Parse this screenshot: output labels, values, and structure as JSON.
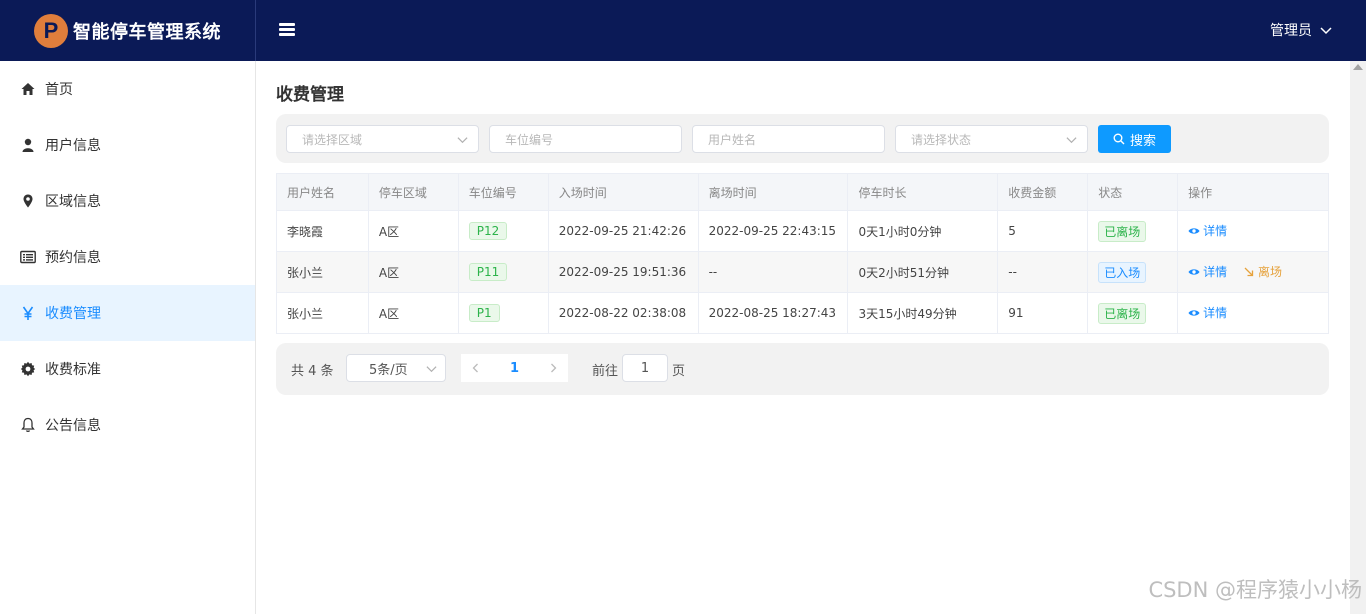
{
  "app": {
    "logo_letter": "P",
    "title": "智能停车管理系统",
    "user_label": "管理员"
  },
  "sidebar": {
    "items": [
      {
        "label": "首页",
        "icon": "home-icon"
      },
      {
        "label": "用户信息",
        "icon": "user-icon"
      },
      {
        "label": "区域信息",
        "icon": "location-icon"
      },
      {
        "label": "预约信息",
        "icon": "list-card-icon"
      },
      {
        "label": "收费管理",
        "icon": "yen-icon",
        "active": true
      },
      {
        "label": "收费标准",
        "icon": "gear-icon"
      },
      {
        "label": "公告信息",
        "icon": "bell-icon"
      }
    ]
  },
  "page": {
    "title": "收费管理"
  },
  "filters": {
    "area_placeholder": "请选择区域",
    "slot_placeholder": "车位编号",
    "username_placeholder": "用户姓名",
    "status_placeholder": "请选择状态",
    "search_label": "搜索"
  },
  "table": {
    "headers": [
      "用户姓名",
      "停车区域",
      "车位编号",
      "入场时间",
      "离场时间",
      "停车时长",
      "收费金额",
      "状态",
      "操作"
    ],
    "rows": [
      {
        "user": "李晓霞",
        "area": "A区",
        "slot": "P12",
        "in_time": "2022-09-25 21:42:26",
        "out_time": "2022-09-25 22:43:15",
        "duration": "0天1小时0分钟",
        "fee": "5",
        "status": "已离场",
        "status_type": "left",
        "detail": "详情",
        "leave": ""
      },
      {
        "user": "张小兰",
        "area": "A区",
        "slot": "P11",
        "in_time": "2022-09-25 19:51:36",
        "out_time": "--",
        "duration": "0天2小时51分钟",
        "fee": "--",
        "status": "已入场",
        "status_type": "in",
        "detail": "详情",
        "leave": "离场"
      },
      {
        "user": "张小兰",
        "area": "A区",
        "slot": "P1",
        "in_time": "2022-08-22 02:38:08",
        "out_time": "2022-08-25 18:27:43",
        "duration": "3天15小时49分钟",
        "fee": "91",
        "status": "已离场",
        "status_type": "left",
        "detail": "详情",
        "leave": ""
      }
    ]
  },
  "pagination": {
    "total": "共 4 条",
    "page_size": "5条/页",
    "current_page": "1",
    "goto_prefix": "前往",
    "goto_value": "1",
    "goto_suffix": "页"
  },
  "watermark": "CSDN @程序猿小小杨",
  "colors": {
    "header_bg": "#0b1a57",
    "accent": "#1a8cff",
    "logo": "#e07e3c",
    "success": "#2cb34a",
    "warning": "#e6a23c"
  }
}
